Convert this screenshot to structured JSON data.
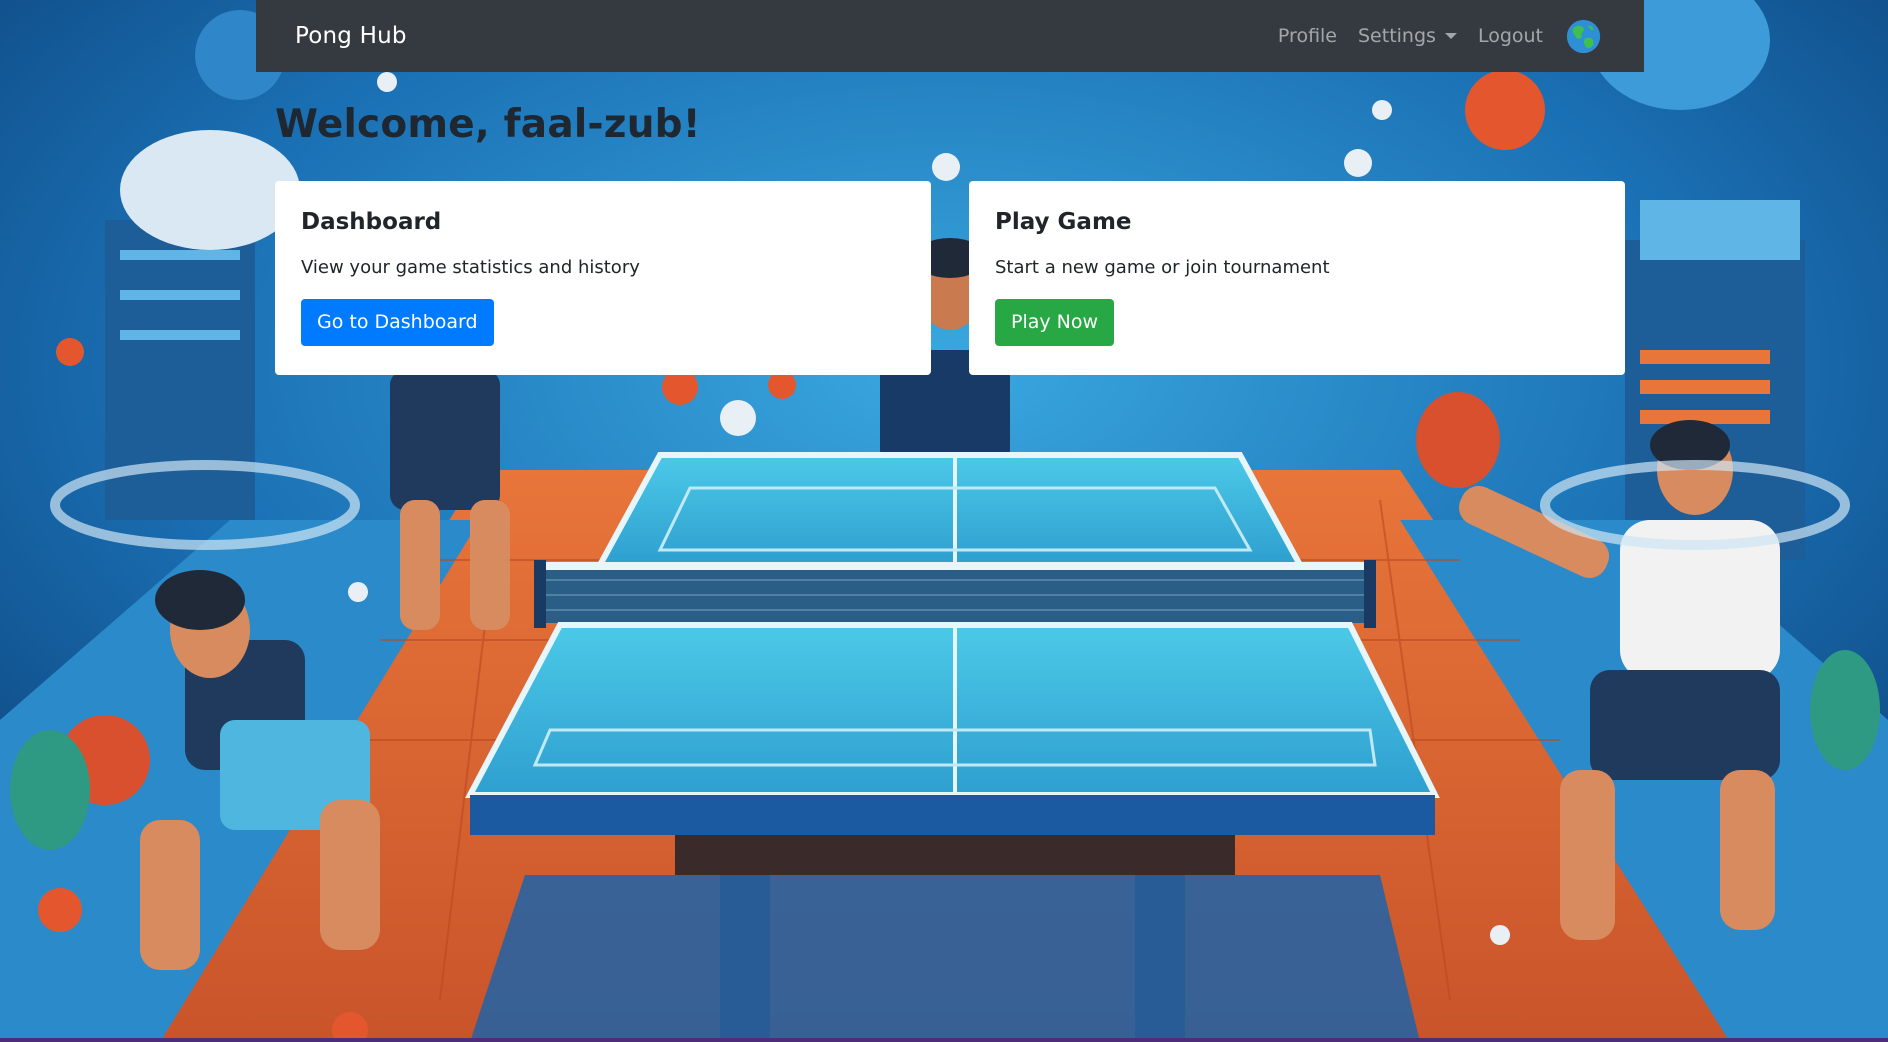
{
  "navbar": {
    "brand": "Pong Hub",
    "links": [
      {
        "label": "Profile"
      },
      {
        "label": "Settings",
        "has_dropdown": true
      },
      {
        "label": "Logout"
      }
    ],
    "language_icon": "globe-icon"
  },
  "main": {
    "welcome": "Welcome, faal-zub!",
    "cards": [
      {
        "title": "Dashboard",
        "text": "View your game statistics and history",
        "button": "Go to Dashboard",
        "button_color": "#007bff"
      },
      {
        "title": "Play Game",
        "text": "Start a new game or join tournament",
        "button": "Play Now",
        "button_color": "#28a745"
      }
    ]
  },
  "colors": {
    "navbar_bg": "#343a40",
    "primary": "#007bff",
    "success": "#28a745",
    "background": "#0f4f8a"
  }
}
